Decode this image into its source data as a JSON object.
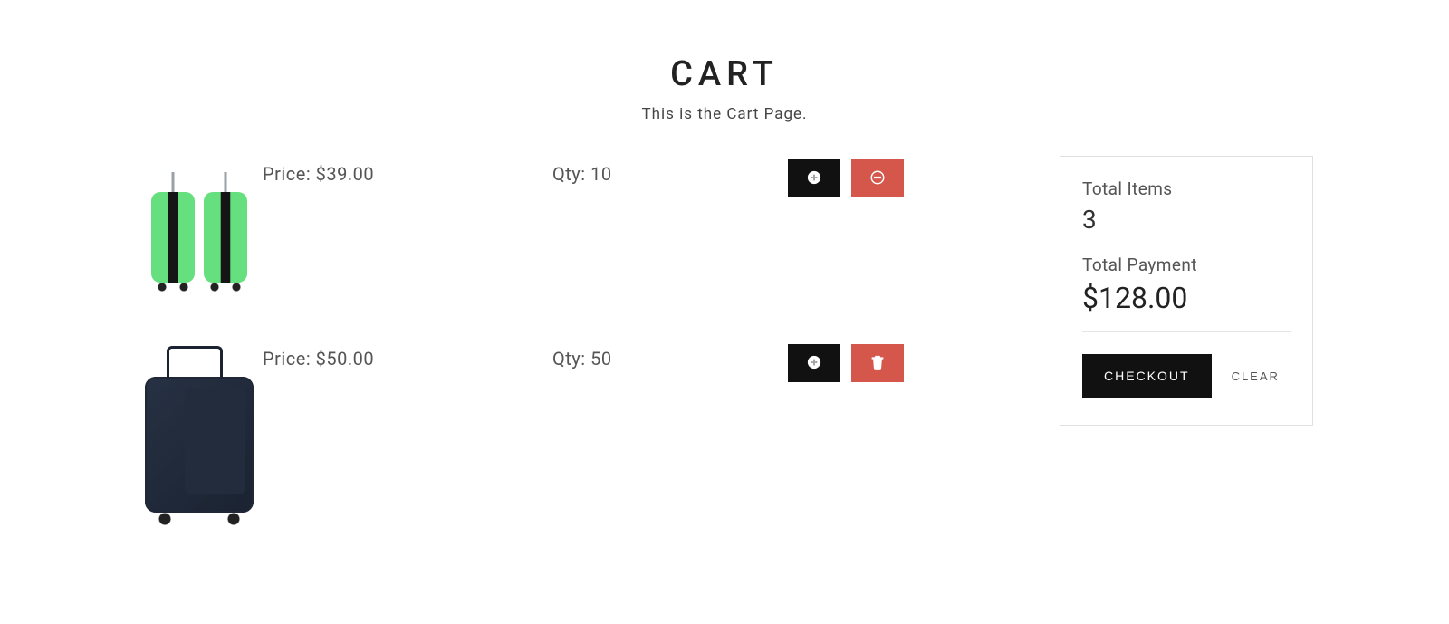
{
  "header": {
    "title": "CART",
    "subtitle": "This is the Cart Page."
  },
  "items": [
    {
      "product_image": "green-suitcase-pair",
      "price_label": "Price: ",
      "price_value": "$39.00",
      "qty_label": "Qty: ",
      "qty_value": "10",
      "inc_icon": "plus-circle-icon",
      "dec_icon": "minus-circle-icon"
    },
    {
      "product_image": "dark-suitcase",
      "price_label": "Price: ",
      "price_value": "$50.00",
      "qty_label": "Qty: ",
      "qty_value": "50",
      "inc_icon": "plus-circle-icon",
      "dec_icon": "trash-icon"
    }
  ],
  "summary": {
    "items_label": "Total Items",
    "items_count": "3",
    "payment_label": "Total Payment",
    "payment_value": "$128.00",
    "checkout_label": "CHECKOUT",
    "clear_label": "CLEAR"
  }
}
